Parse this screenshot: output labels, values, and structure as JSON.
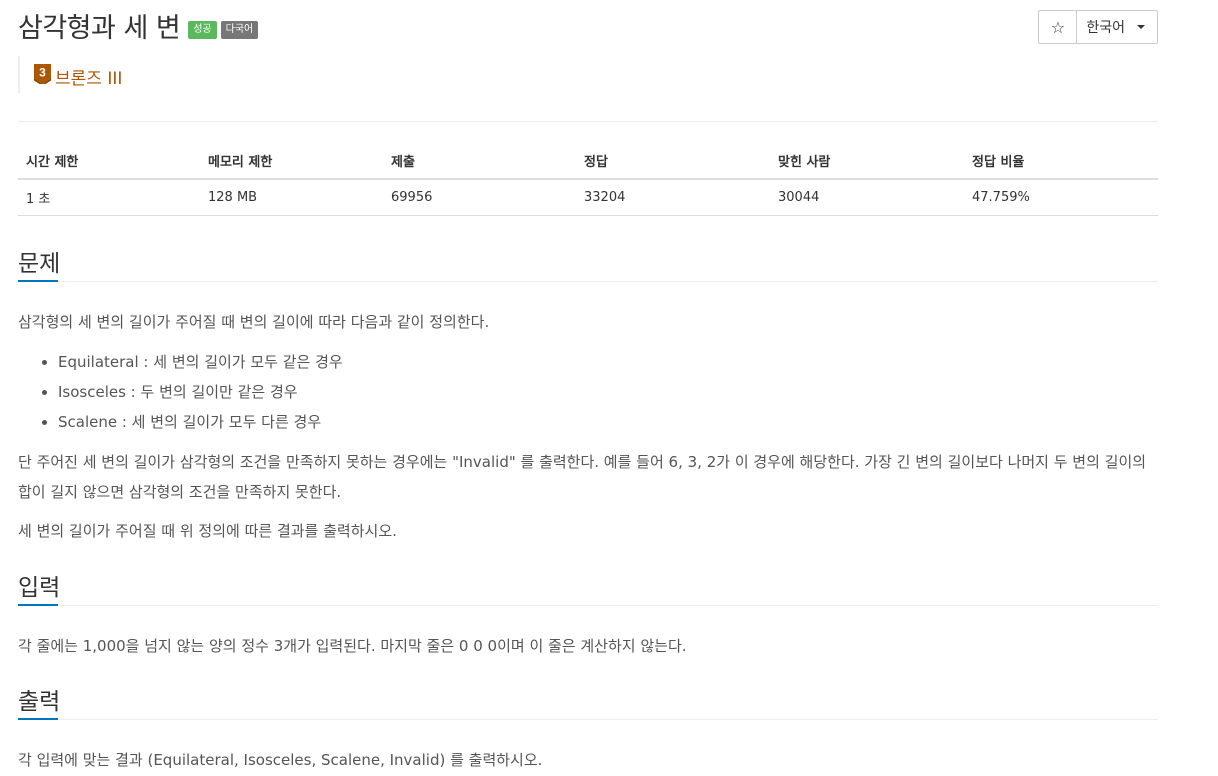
{
  "header": {
    "title": "삼각형과 세 변",
    "badge_success": "성공",
    "badge_multilang": "다국어",
    "tier_number": "3",
    "tier_label": "브론즈 III",
    "star_icon": "☆",
    "language": "한국어"
  },
  "info_table": {
    "headers": [
      "시간 제한",
      "메모리 제한",
      "제출",
      "정답",
      "맞힌 사람",
      "정답 비율"
    ],
    "values": [
      "1 초",
      "128 MB",
      "69956",
      "33204",
      "30044",
      "47.759%"
    ]
  },
  "sections": {
    "problem": {
      "title": "문제",
      "intro": "삼각형의 세 변의 길이가 주어질 때 변의 길이에 따라 다음과 같이 정의한다.",
      "bullets": [
        "Equilateral :  세 변의 길이가 모두 같은 경우",
        "Isosceles : 두 변의 길이만 같은 경우",
        "Scalene : 세 변의 길이가 모두 다른 경우"
      ],
      "para2": "단 주어진 세 변의 길이가 삼각형의 조건을 만족하지 못하는 경우에는 \"Invalid\" 를 출력한다. 예를 들어 6, 3, 2가 이 경우에 해당한다. 가장 긴 변의 길이보다 나머지 두 변의 길이의 합이 길지 않으면 삼각형의 조건을 만족하지 못한다.",
      "para3": "세 변의 길이가 주어질 때 위 정의에 따른 결과를 출력하시오."
    },
    "input": {
      "title": "입력",
      "text": "각 줄에는 1,000을 넘지 않는 양의 정수 3개가 입력된다. 마지막 줄은 0 0 0이며 이 줄은 계산하지 않는다."
    },
    "output": {
      "title": "출력",
      "text": "각 입력에 맞는 결과 (Equilateral, Isosceles, Scalene, Invalid) 를 출력하시오."
    }
  },
  "colors": {
    "accent": "#0076c0",
    "bronze": "#ad5600",
    "success": "#5cb85c",
    "multilang": "#777777"
  }
}
